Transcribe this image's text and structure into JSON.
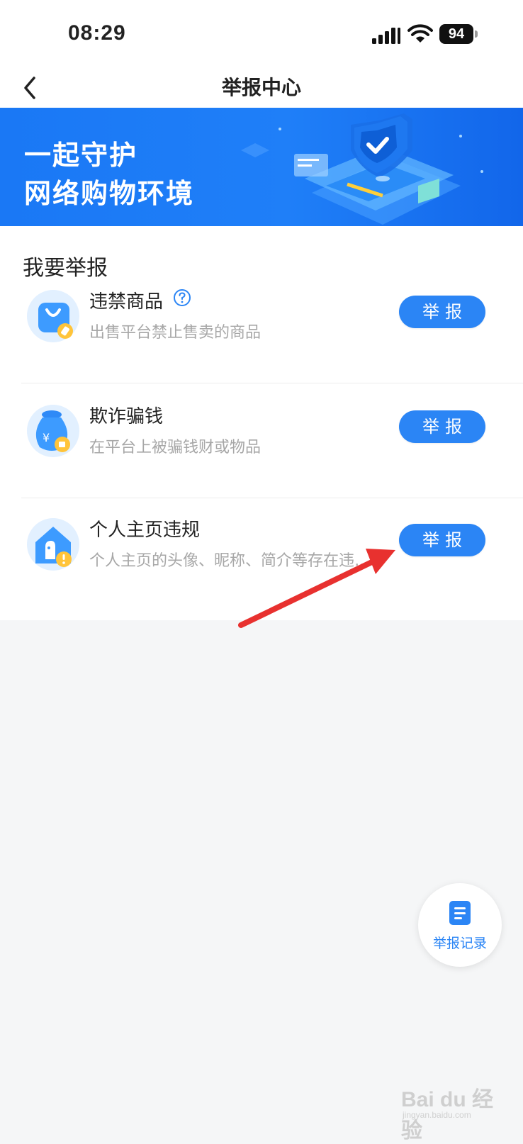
{
  "status_bar": {
    "time": "08:29",
    "battery": "94"
  },
  "nav": {
    "title": "举报中心"
  },
  "banner": {
    "line1": "一起守护",
    "line2": "网络购物环境"
  },
  "section": {
    "title": "我要举报",
    "items": [
      {
        "title": "违禁商品",
        "desc": "出售平台禁止售卖的商品",
        "button": "举报",
        "has_help": true
      },
      {
        "title": "欺诈骗钱",
        "desc": "在平台上被骗钱财或物品",
        "button": "举报",
        "has_help": false
      },
      {
        "title": "个人主页违规",
        "desc": "个人主页的头像、昵称、简介等存在违…",
        "button": "举报",
        "has_help": false
      }
    ]
  },
  "fab": {
    "label": "举报记录"
  },
  "watermark": {
    "text": "Bai du 经验",
    "sub": "jingyan.baidu.com"
  },
  "colors": {
    "primary": "#2b85f5",
    "banner": "#1a78f5",
    "arrow": "#e8312f"
  }
}
